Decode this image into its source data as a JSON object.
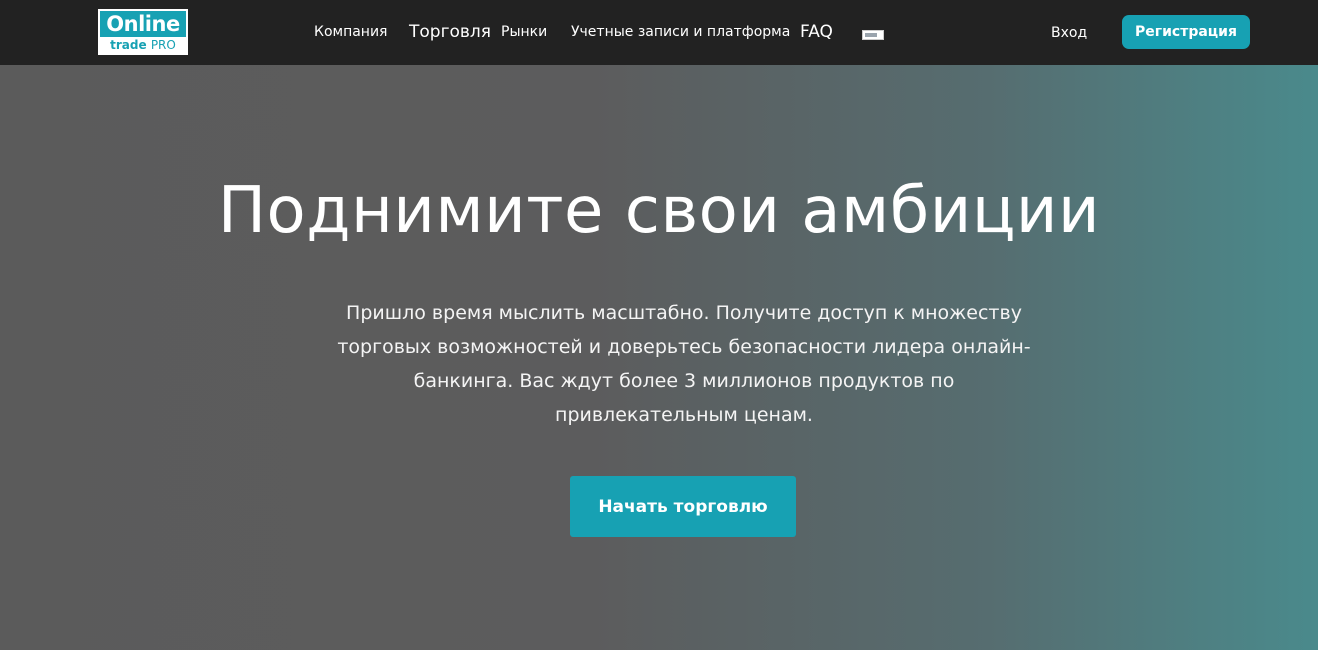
{
  "header": {
    "logo": {
      "line1": "Online",
      "line2_a": "trade",
      "line2_b": "PRO"
    },
    "nav": [
      {
        "label": "Компания"
      },
      {
        "label": "Торговля"
      },
      {
        "label": "Рынки"
      },
      {
        "label": "Учетные записи и платформа"
      },
      {
        "label": "FAQ"
      }
    ],
    "language_icon": "flag-icon",
    "login_label": "Вход",
    "register_label": "Регистрация"
  },
  "hero": {
    "title": "Поднимите свои амбиции",
    "text": "Пришло время мыслить масштабно. Получите доступ к множеству торговых возможностей и доверьтесь безопасности лидера онлайн-банкинга. Вас ждут более 3 миллионов продуктов по привлекательным ценам.",
    "cta_label": "Начать торговлю"
  },
  "colors": {
    "header_bg": "#222222",
    "accent": "#17a1b3",
    "hero_left": "#5b5b5b",
    "hero_right": "#4a8a8c"
  }
}
